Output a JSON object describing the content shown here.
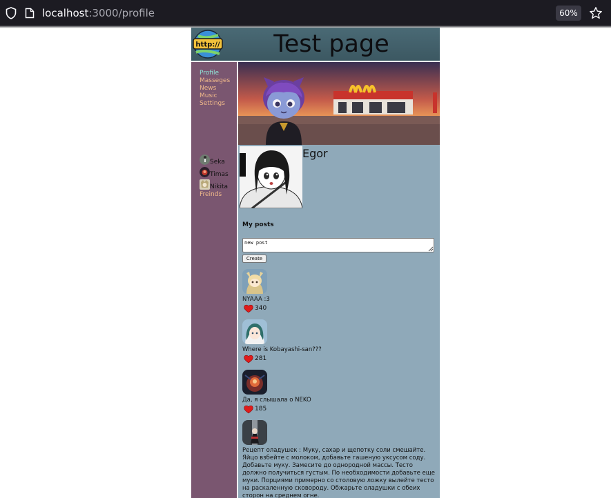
{
  "browser": {
    "url_host": "localhost",
    "url_path": ":3000/profile",
    "zoom": "60%"
  },
  "header": {
    "title": "Test page",
    "logo_text": "http://"
  },
  "nav": {
    "items": [
      {
        "label": "Profile",
        "active": true
      },
      {
        "label": "Masseges",
        "active": false
      },
      {
        "label": "News",
        "active": false
      },
      {
        "label": "Music",
        "active": false
      },
      {
        "label": "Settings",
        "active": false
      }
    ],
    "friends": [
      {
        "name": "Seka"
      },
      {
        "name": "Timas"
      },
      {
        "name": "Nikita"
      }
    ],
    "friends_link": "Freinds"
  },
  "profile": {
    "name": "Egor"
  },
  "posts_section": {
    "title": "My posts",
    "textarea_value": "new post",
    "create_label": "Create"
  },
  "posts": [
    {
      "text": "NYAAA :3",
      "likes": "340"
    },
    {
      "text": "Where is Kobayashi-san???",
      "likes": "281"
    },
    {
      "text": "Да, я слышала о NEKO",
      "likes": "185"
    },
    {
      "text": "Рецепт оладушек : Муку, сахар и щепотку соли смешайте. Яйцо взбейте с молоком, добавьте гашеную уксусом соду. Добавьте муку. Замесите до однородной массы. Тесто должно получиться густым. По необходимости добавьте еще муки. Порциями примерно со столовую ложку вылейте тесто на раскаленную сковороду. Обжарьте оладушки с обеих сторон на среднем огне."
    }
  ],
  "colors": {
    "header_bg": "#4a6a75",
    "sidebar_bg": "#7a5670",
    "content_bg": "#8fa9b9",
    "nav_link": "#f0b98a",
    "nav_active": "#8fe5d8"
  }
}
